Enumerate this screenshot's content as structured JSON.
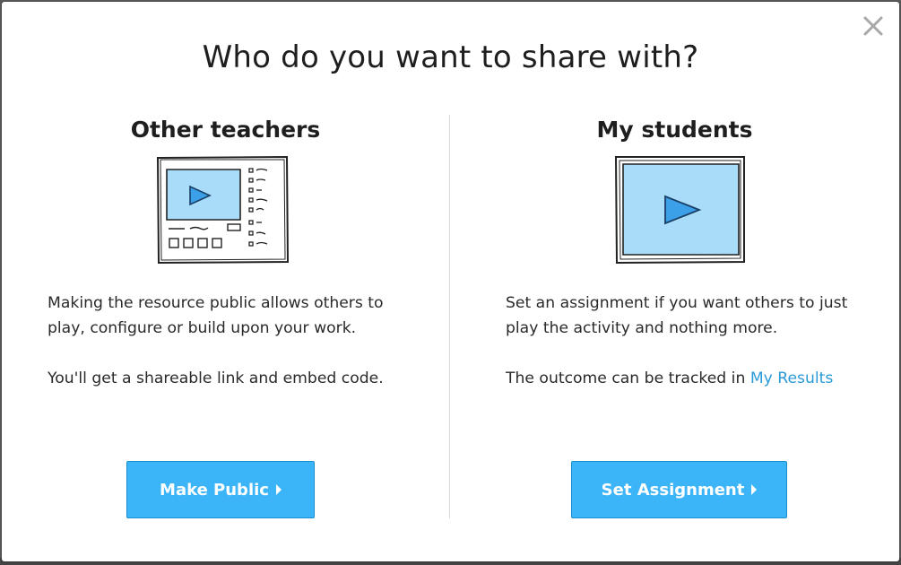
{
  "modal": {
    "title": "Who do you want to share with?",
    "close_icon": "close-icon"
  },
  "left": {
    "heading": "Other teachers",
    "illustration": "resource-page-illustration",
    "paragraphs": [
      "Making the resource public allows others to play, configure or build upon your work.",
      "You'll get a shareable link and embed code."
    ],
    "button_label": "Make Public",
    "button_icon": "caret-right-icon"
  },
  "right": {
    "heading": "My students",
    "illustration": "video-player-illustration",
    "paragraph1": "Set an assignment if you want others to just play the activity and nothing more.",
    "paragraph2_prefix": "The outcome can be tracked in ",
    "link_text": "My Results",
    "button_label": "Set Assignment",
    "button_icon": "caret-right-icon"
  },
  "colors": {
    "accent": "#3cb4f8",
    "link": "#2a9ad8",
    "illustration_fill": "#a8dcf8",
    "play_icon": "#2a90dc"
  }
}
